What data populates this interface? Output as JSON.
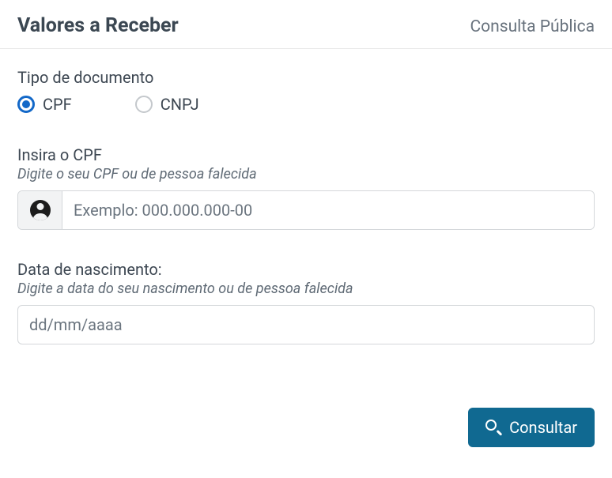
{
  "header": {
    "title": "Valores a Receber",
    "subtitle": "Consulta Pública"
  },
  "doc_type": {
    "label": "Tipo de documento",
    "options": {
      "cpf": "CPF",
      "cnpj": "CNPJ"
    }
  },
  "cpf_field": {
    "label": "Insira o CPF",
    "hint": "Digite o seu CPF ou de pessoa falecida",
    "placeholder": "Exemplo: 000.000.000-00"
  },
  "dob_field": {
    "label": "Data de nascimento:",
    "hint": "Digite a data do seu nascimento ou de pessoa falecida",
    "placeholder": "dd/mm/aaaa"
  },
  "submit": {
    "label": "Consultar"
  }
}
